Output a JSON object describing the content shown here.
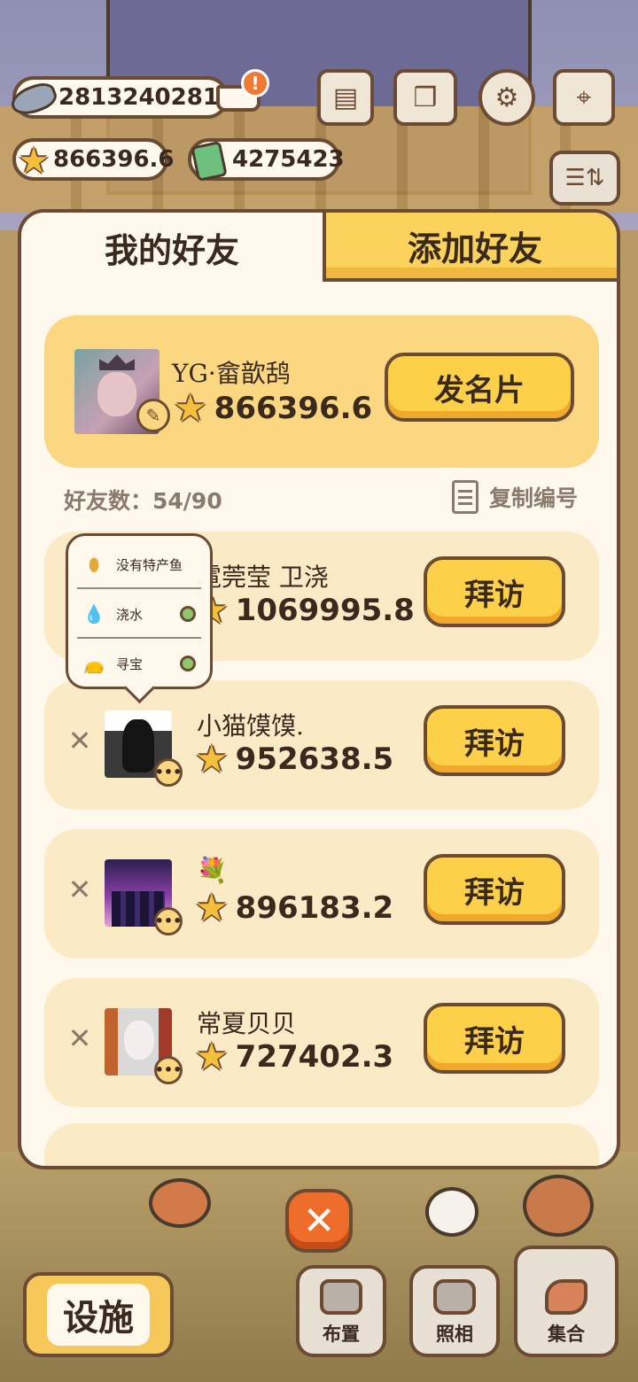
{
  "hud": {
    "fish_value": "2813240281",
    "cart_badge": "!",
    "star_value": "866396.6",
    "ticket_value": "4275423",
    "top_icons": [
      "newspaper-icon",
      "album-icon",
      "gear-icon",
      "map-icon"
    ]
  },
  "tabs": {
    "my_friends": "我的好友",
    "add_friend": "添加好友"
  },
  "my_card": {
    "name": "YG·畲歆鸹",
    "score": "866396.6",
    "send_card_label": "发名片"
  },
  "friend_count": {
    "label": "好友数：54/90"
  },
  "copy_id": {
    "label": "复制编号"
  },
  "friends": [
    {
      "name": "霓莞莹 卫浇",
      "score": "1069995.8",
      "visit_label": "拜访"
    },
    {
      "name": "小猫馍馍.",
      "score": "952638.5",
      "visit_label": "拜访"
    },
    {
      "name": "💐",
      "score": "896183.2",
      "visit_label": "拜访"
    },
    {
      "name": "常夏贝贝",
      "score": "727402.3",
      "visit_label": "拜访"
    }
  ],
  "tooltip": {
    "items": [
      {
        "label": "没有特产鱼",
        "icon": "peanut-icon"
      },
      {
        "label": "浇水",
        "icon": "water-drop-icon"
      },
      {
        "label": "寻宝",
        "icon": "treasure-bag-icon"
      }
    ]
  },
  "close_label": "✕",
  "bottom": {
    "facility_label": "设施",
    "layout_label": "布置",
    "photo_label": "照相",
    "gather_label": "集合"
  },
  "colors": {
    "accent_yellow": "#fdd04a",
    "close_orange": "#ee6d2a",
    "border_brown": "#6b4b33",
    "panel_bg": "#fff8ed"
  }
}
